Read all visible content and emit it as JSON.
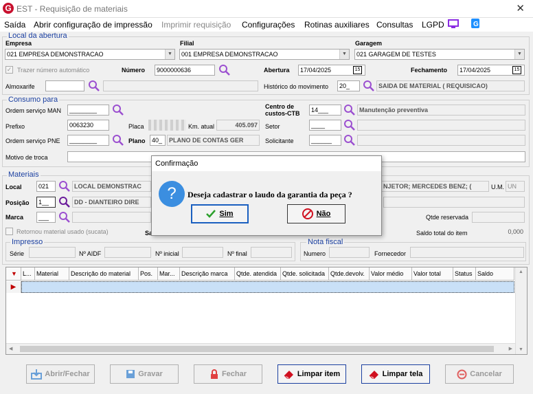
{
  "window": {
    "title": "EST - Requisição de materiais",
    "logo": "G",
    "close": "✕"
  },
  "menu": [
    "Saída",
    "Abrir configuração de impressão",
    "Imprimir requisição",
    "Configurações",
    "Rotinas auxiliares",
    "Consultas",
    "LGPD"
  ],
  "local_abertura": {
    "legend": "Local da abertura",
    "empresa_label": "Empresa",
    "empresa": "021 EMPRESA DEMONSTRACAO",
    "filial_label": "Filial",
    "filial": "001 EMPRESA DEMONSTRACAO",
    "garagem_label": "Garagem",
    "garagem": "021 GARAGEM DE TESTES",
    "trazer_label": "Trazer número automático",
    "numero_label": "Número",
    "numero": "9000000636",
    "abertura_label": "Abertura",
    "abertura": "17/04/2025",
    "fechamento_label": "Fechamento",
    "fechamento": "17/04/2025",
    "cal": "15",
    "almoxarife_label": "Almoxarife",
    "almoxarife": "",
    "historico_label": "Histórico do movimento",
    "historico_code": "20_",
    "historico": "SAIDA DE MATERIAL ( REQUISICAO)"
  },
  "consumo": {
    "legend": "Consumo para",
    "os_man_label": "Ordem serviço MAN",
    "os_man": "________",
    "prefixo_label": "Prefixo",
    "prefixo": "0063230",
    "placa_label": "Placa",
    "km_label": "Km. atual",
    "km": "405.097",
    "os_pne_label": "Ordem serviço PNE",
    "os_pne": "________",
    "plano_label": "Plano",
    "plano_code": "40_",
    "plano": "PLANO DE CONTAS GER",
    "motivo_label": "Motivo de troca",
    "motivo": "",
    "cc_label": "Centro de custos-CTB",
    "cc_code": "14___",
    "cc": "Manutenção preventiva",
    "setor_label": "Setor",
    "setor": "____",
    "solicitante_label": "Solicitante",
    "solicitante": "______"
  },
  "materiais": {
    "legend": "Materiais",
    "local_label": "Local",
    "local_code": "021",
    "local": "LOCAL DEMONSTRAC",
    "posicao_label": "Posição",
    "posicao_code": "1__",
    "posicao": "DD - DIANTEIRO DIRE",
    "marca_label": "Marca",
    "marca": "___",
    "material_text": "NJETOR; MERCEDES BENZ; (",
    "um_label": "U.M.",
    "um": "UN",
    "qtde_reservada_label": "Qtde reservada",
    "qtde_reservada": "",
    "retornou_label": "Retornou material usado (sucata)",
    "saldo_label": "Saldo total do item",
    "saldo": "0,000",
    "sa_label": "Sa"
  },
  "impresso": {
    "legend": "Impresso",
    "serie_label": "Série",
    "aidf_label": "Nº AIDF",
    "inicial_label": "Nº inicial",
    "final_label": "Nº final"
  },
  "nota": {
    "legend": "Nota fiscal",
    "numero_label": "Numero",
    "fornecedor_label": "Fornecedor"
  },
  "grid": {
    "columns": [
      "L...",
      "Material",
      "Descrição do material",
      "Pos.",
      "Mar...",
      "Descrição marca",
      "Qtde. atendida",
      "Qtde. solicitada",
      "Qtde.devolv.",
      "Valor médio",
      "Valor total",
      "Status",
      "Saldo"
    ]
  },
  "buttons": {
    "abrir": "Abrir/Fechar",
    "gravar": "Gravar",
    "fechar": "Fechar",
    "limpar_item": "Limpar item",
    "limpar_tela": "Limpar tela",
    "cancelar": "Cancelar"
  },
  "dialog": {
    "title": "Confirmação",
    "message": "Deseja cadastrar o laudo da garantia da peça ?",
    "yes": "Sim",
    "no": "Não",
    "icon": "?"
  },
  "colors": {
    "accent": "#1a3fa0",
    "magnifier": "#9b4fd0",
    "dialog_icon": "#3b8ee0",
    "grid_selected": "#c9e0f7",
    "grid_marker": "#c00000"
  }
}
